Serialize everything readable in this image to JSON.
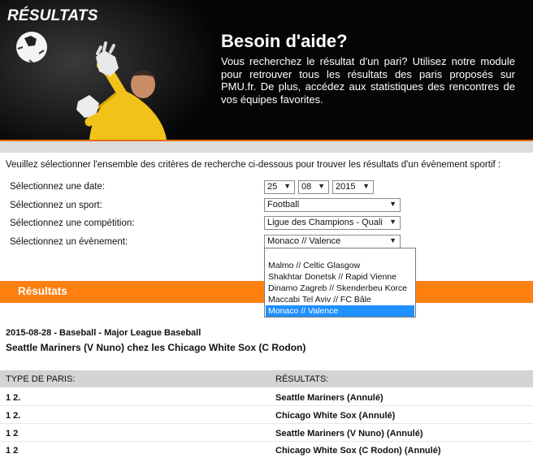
{
  "hero": {
    "title": "RÉSULTATS",
    "help_title": "Besoin d'aide?",
    "help_text": "Vous recherchez le résultat d'un pari? Utilisez notre module pour retrouver tous les résultats des paris proposés sur PMU.fr. De plus, accédez aux statistiques des rencontres de vos équipes favorites."
  },
  "form": {
    "intro": "Veuillez sélectionner l'ensemble des critères de recherche ci-dessous pour trouver les résultats d'un évènement sportif :",
    "date_label": "Sélectionnez une date:",
    "date_day": "25",
    "date_month": "08",
    "date_year": "2015",
    "sport_label": "Sélectionnez un sport:",
    "sport_value": "Football",
    "competition_label": "Sélectionnez une compétition:",
    "competition_value": "Ligue des Champions - Quali",
    "event_label": "Sélectionnez un évènement:",
    "event_value": "Monaco // Valence",
    "event_options": [
      "Malmo // Celtic Glasgow",
      "Shakhtar Donetsk // Rapid Vienne",
      "Dinamo Zagreb // Skenderbeu Korce",
      "Maccabi Tel Aviv // FC Bâle",
      "Monaco // Valence"
    ]
  },
  "results": {
    "bar_title": "Résultats",
    "event_date": "2015-08-28 - Baseball - Major League Baseball",
    "event_title": "Seattle Mariners (V Nuno) chez les Chicago White Sox (C Rodon)",
    "col_bet_type": "TYPE DE PARIS:",
    "col_results": "RÉSULTATS:",
    "rows": [
      {
        "bet": "1 2.",
        "result": "Seattle Mariners (Annulé)"
      },
      {
        "bet": "1 2.",
        "result": "Chicago White Sox (Annulé)"
      },
      {
        "bet": "1 2",
        "result": "Seattle Mariners (V Nuno) (Annulé)"
      },
      {
        "bet": "1 2",
        "result": "Chicago White Sox (C Rodon) (Annulé)"
      }
    ]
  },
  "colors": {
    "accent_orange": "#ff7f0f",
    "selection_blue": "#1e90ff"
  }
}
